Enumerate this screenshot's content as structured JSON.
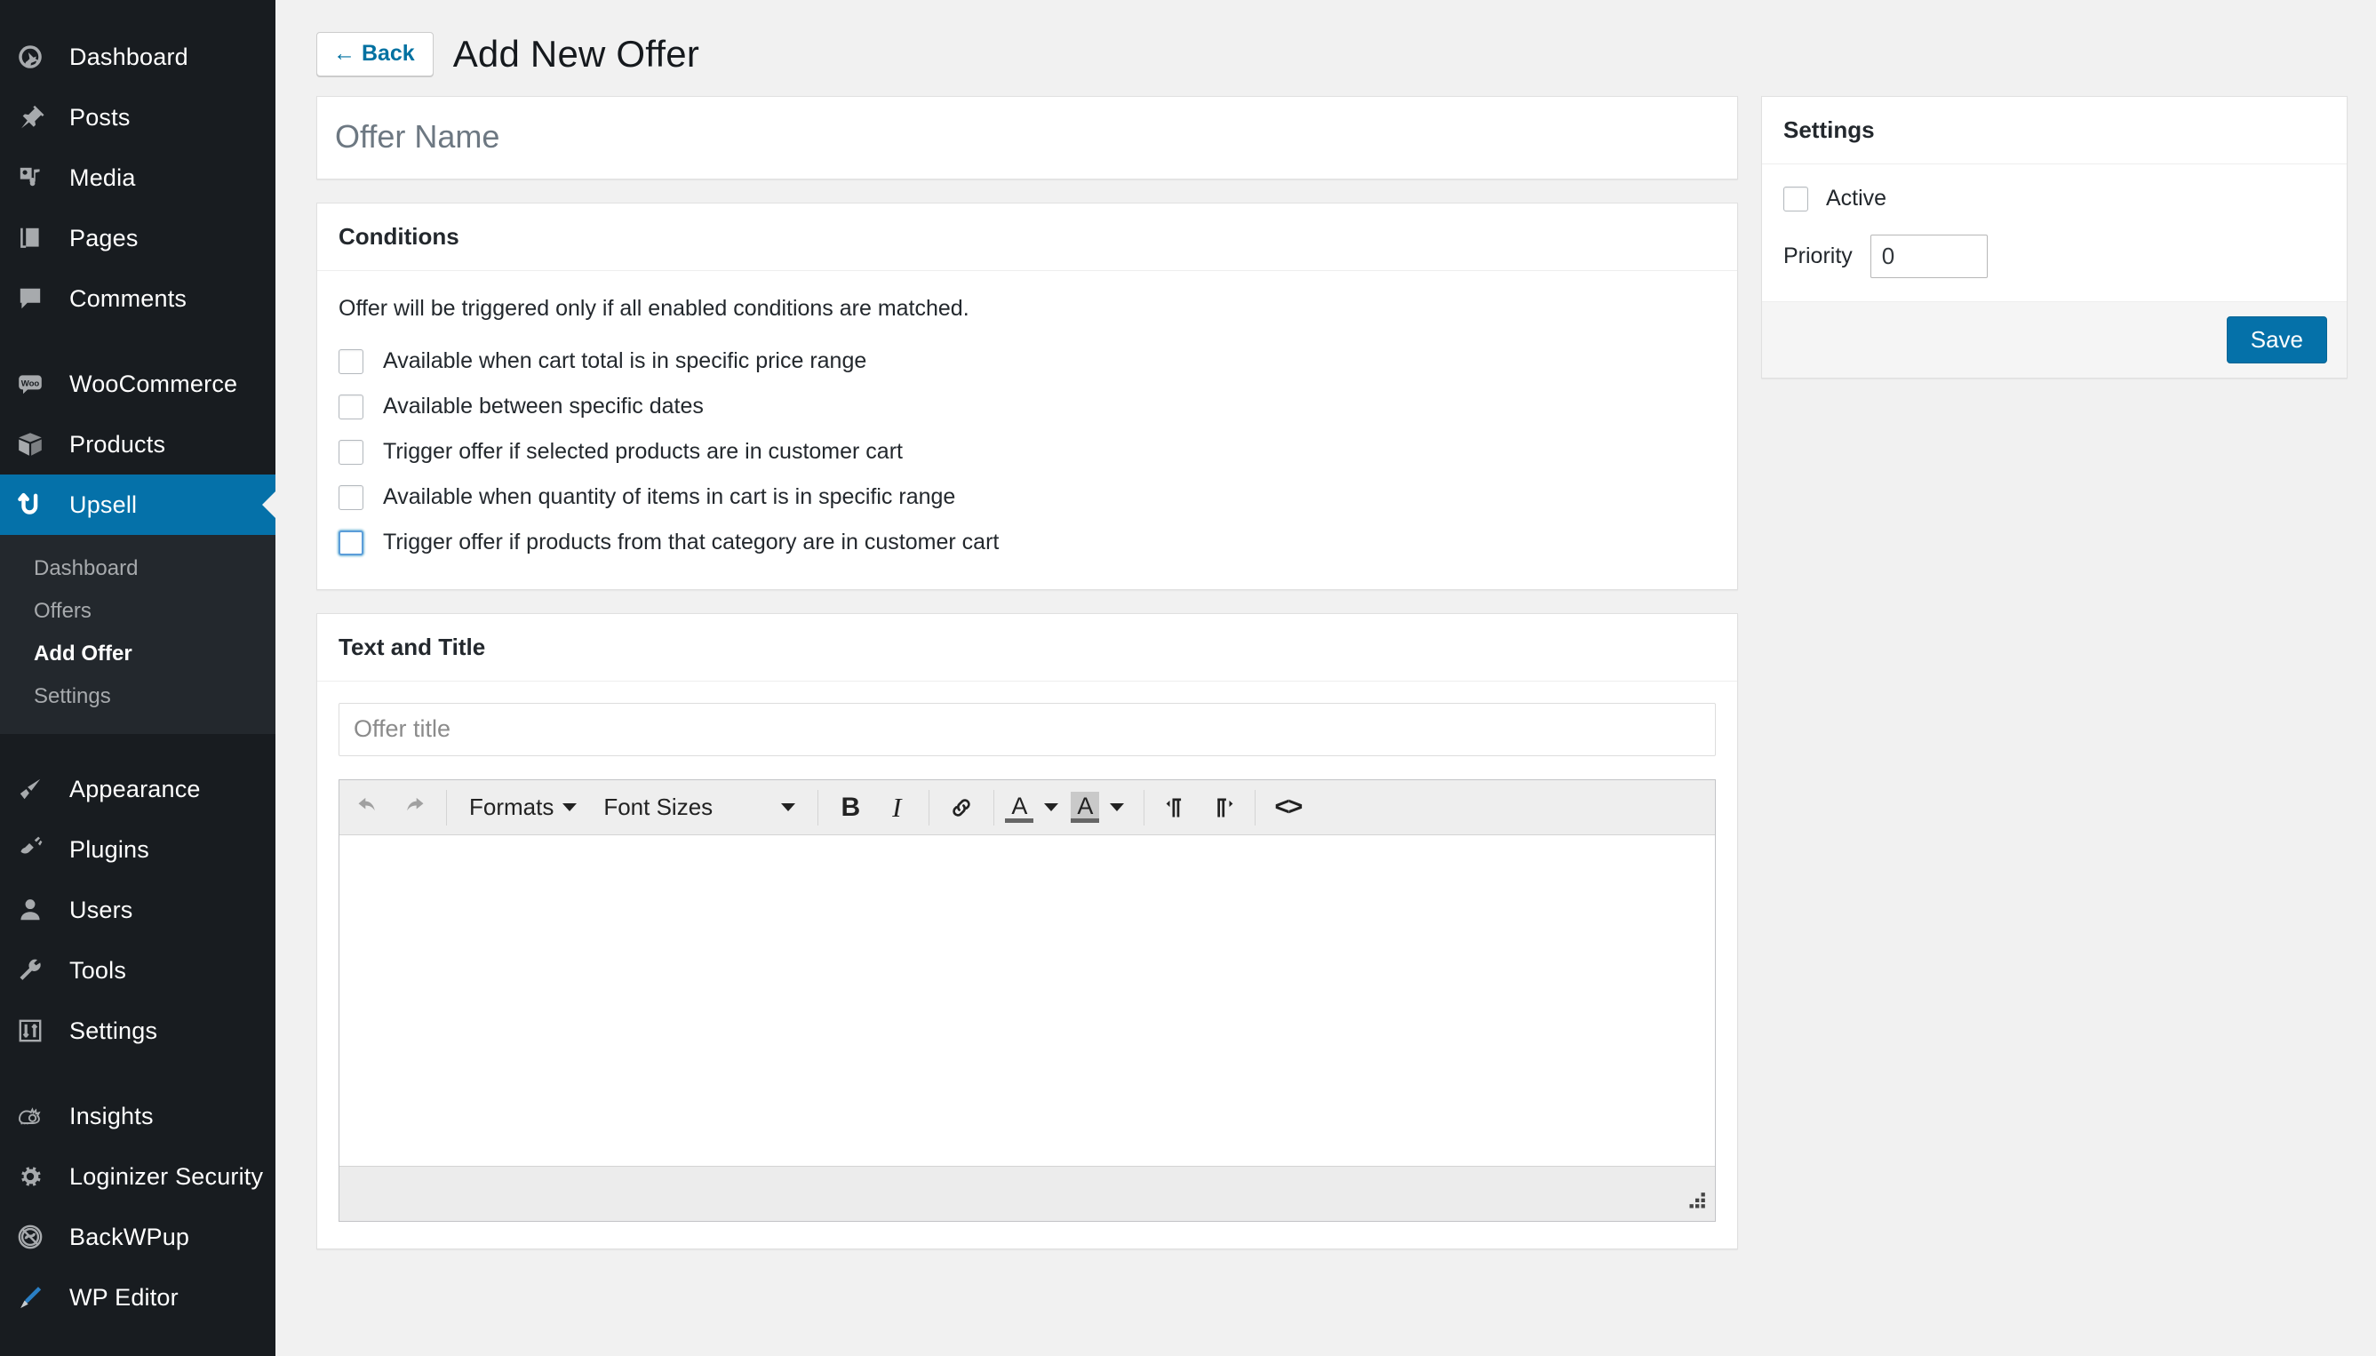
{
  "sidebar": {
    "groups": [
      {
        "items": [
          {
            "label": "Dashboard",
            "icon": "dashboard-icon"
          },
          {
            "label": "Posts",
            "icon": "pin-icon"
          },
          {
            "label": "Media",
            "icon": "media-icon"
          },
          {
            "label": "Pages",
            "icon": "pages-icon"
          },
          {
            "label": "Comments",
            "icon": "comment-icon"
          }
        ]
      },
      {
        "items": [
          {
            "label": "WooCommerce",
            "icon": "woo-icon"
          },
          {
            "label": "Products",
            "icon": "box-icon"
          },
          {
            "label": "Upsell",
            "icon": "upsell-arrow-icon",
            "current": true
          }
        ]
      },
      {
        "items": [
          {
            "label": "Appearance",
            "icon": "brush-icon"
          },
          {
            "label": "Plugins",
            "icon": "plug-icon"
          },
          {
            "label": "Users",
            "icon": "user-icon"
          },
          {
            "label": "Tools",
            "icon": "wrench-icon"
          },
          {
            "label": "Settings",
            "icon": "sliders-icon"
          }
        ]
      },
      {
        "items": [
          {
            "label": "Insights",
            "icon": "insights-icon"
          },
          {
            "label": "Loginizer Security",
            "icon": "gear-icon"
          },
          {
            "label": "BackWPup",
            "icon": "backwpup-icon"
          },
          {
            "label": "WP Editor",
            "icon": "pencil-icon"
          }
        ]
      }
    ],
    "submenu": [
      {
        "label": "Dashboard"
      },
      {
        "label": "Offers"
      },
      {
        "label": "Add Offer",
        "current": true
      },
      {
        "label": "Settings"
      }
    ]
  },
  "header": {
    "back_label": "← Back",
    "title": "Add New Offer"
  },
  "offer_name": {
    "value": "",
    "placeholder": "Offer Name"
  },
  "conditions": {
    "heading": "Conditions",
    "note": "Offer will be triggered only if all enabled conditions are matched.",
    "items": [
      {
        "label": "Available when cart total is in specific price range",
        "checked": false,
        "focused": false
      },
      {
        "label": "Available between specific dates",
        "checked": false,
        "focused": false
      },
      {
        "label": "Trigger offer if selected products are in customer cart",
        "checked": false,
        "focused": false
      },
      {
        "label": "Available when quantity of items in cart is in specific range",
        "checked": false,
        "focused": false
      },
      {
        "label": "Trigger offer if products from that category are in customer cart",
        "checked": false,
        "focused": true
      }
    ]
  },
  "text_and_title": {
    "heading": "Text and Title",
    "offer_title": {
      "value": "",
      "placeholder": "Offer title"
    },
    "toolbar": {
      "undo": "undo-icon",
      "redo": "redo-icon",
      "formats_label": "Formats",
      "font_sizes_label": "Font Sizes",
      "bold": "B",
      "italic": "I",
      "link": "link-icon",
      "text_color": "A",
      "background_color": "A",
      "ltr": "ltr-icon",
      "rtl": "rtl-icon",
      "source_code": "<>"
    },
    "content": ""
  },
  "settings": {
    "heading": "Settings",
    "active_label": "Active",
    "active_checked": false,
    "priority_label": "Priority",
    "priority_value": "0",
    "save_label": "Save"
  },
  "colors": {
    "accent_blue": "#0571a9",
    "sidebar_bg": "#181c20",
    "submenu_bg": "#23282d",
    "page_bg": "#f1f1f1",
    "focus_blue": "#5b9dd9"
  }
}
